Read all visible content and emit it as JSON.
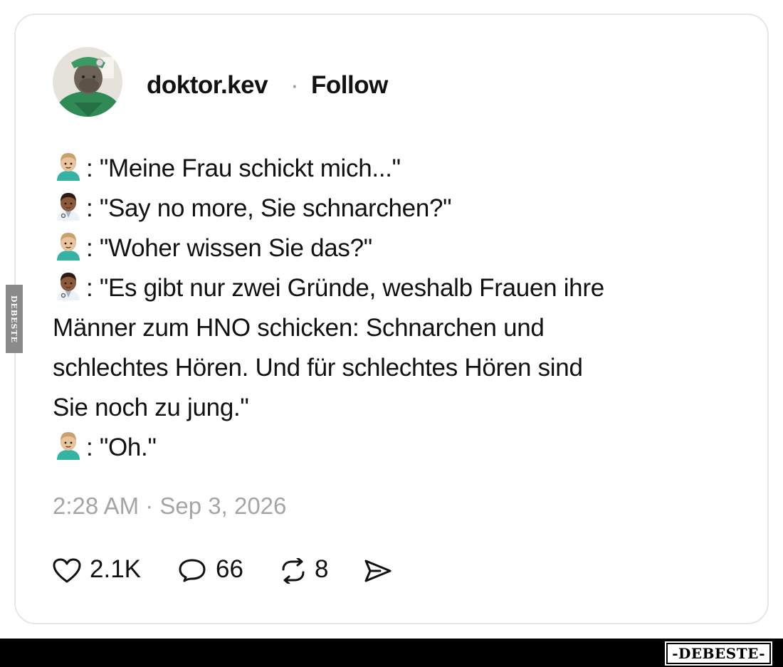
{
  "post": {
    "username": "doktor.kev",
    "separator": "·",
    "follow_label": "Follow",
    "lines": [
      {
        "speaker": "patient",
        "text": ": \"Meine Frau schickt mich...\""
      },
      {
        "speaker": "doctor",
        "text": ": \"Say no more, Sie schnarchen?\""
      },
      {
        "speaker": "patient",
        "text": ": \"Woher wissen Sie das?\""
      },
      {
        "speaker": "doctor",
        "text": ": \"Es gibt nur zwei Gründe, weshalb Frauen ihre"
      },
      {
        "speaker": "",
        "text": "Männer zum HNO schicken: Schnarchen und"
      },
      {
        "speaker": "",
        "text": "schlechtes Hören. Und für schlechtes Hören sind"
      },
      {
        "speaker": "",
        "text": "Sie noch zu jung.\""
      },
      {
        "speaker": "patient",
        "text": ": \"Oh.\""
      }
    ],
    "timestamp": "2:28 AM · Sep 3, 2026",
    "likes": "2.1K",
    "replies": "66",
    "reposts": "8"
  },
  "icons": {
    "like": "heart-icon",
    "reply": "speech-bubble-icon",
    "repost": "repost-arrows-icon",
    "share": "send-icon"
  },
  "watermark": {
    "side_text": "DEBESTE",
    "logo_text": "-DEBESTE-"
  },
  "colors": {
    "timestamp": "#a5a5a5",
    "footer": "#000000",
    "card_border": "#e6e6e6"
  }
}
